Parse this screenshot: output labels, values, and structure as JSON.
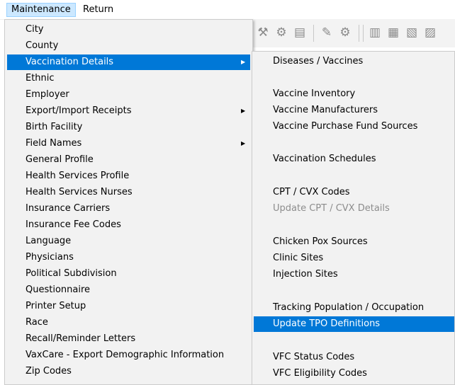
{
  "menubar": {
    "items": [
      "Maintenance",
      "Return"
    ]
  },
  "toolbar": {
    "icons": [
      "tools-icon",
      "gear-icon",
      "align-icon",
      "sliders-icon",
      "settings-icon",
      "align-left-icon",
      "align-right-icon",
      "align-top-icon",
      "align-bottom-icon"
    ]
  },
  "main_menu": {
    "items": [
      {
        "label": "City"
      },
      {
        "label": "County"
      },
      {
        "label": "Vaccination Details",
        "submenu": true,
        "selected": true
      },
      {
        "label": "Ethnic"
      },
      {
        "label": "Employer"
      },
      {
        "label": "Export/Import Receipts",
        "submenu": true
      },
      {
        "label": "Birth Facility"
      },
      {
        "label": "Field Names",
        "submenu": true
      },
      {
        "label": "General Profile"
      },
      {
        "label": "Health Services Profile"
      },
      {
        "label": "Health Services Nurses"
      },
      {
        "label": "Insurance Carriers"
      },
      {
        "label": "Insurance Fee Codes"
      },
      {
        "label": "Language"
      },
      {
        "label": "Physicians"
      },
      {
        "label": "Political Subdivision"
      },
      {
        "label": "Questionnaire"
      },
      {
        "label": "Printer Setup"
      },
      {
        "label": "Race"
      },
      {
        "label": "Recall/Reminder Letters"
      },
      {
        "label": "VaxCare - Export Demographic Information"
      },
      {
        "label": "Zip Codes"
      }
    ]
  },
  "sub_menu": {
    "items": [
      {
        "label": "Diseases / Vaccines"
      },
      {
        "label": ""
      },
      {
        "label": "Vaccine Inventory"
      },
      {
        "label": "Vaccine Manufacturers"
      },
      {
        "label": "Vaccine Purchase Fund Sources"
      },
      {
        "label": ""
      },
      {
        "label": "Vaccination Schedules"
      },
      {
        "label": ""
      },
      {
        "label": "CPT / CVX Codes"
      },
      {
        "label": "Update CPT / CVX  Details",
        "disabled": true
      },
      {
        "label": ""
      },
      {
        "label": "Chicken Pox Sources"
      },
      {
        "label": "Clinic Sites"
      },
      {
        "label": "Injection Sites"
      },
      {
        "label": ""
      },
      {
        "label": "Tracking Population / Occupation"
      },
      {
        "label": "Update TPO Definitions",
        "selected": true
      },
      {
        "label": ""
      },
      {
        "label": "VFC Status Codes"
      },
      {
        "label": "VFC Eligibility Codes"
      }
    ]
  },
  "colors": {
    "highlight": "#0078d7",
    "menu_background": "#f2f2f2",
    "disabled_text": "#8d8d8d"
  }
}
